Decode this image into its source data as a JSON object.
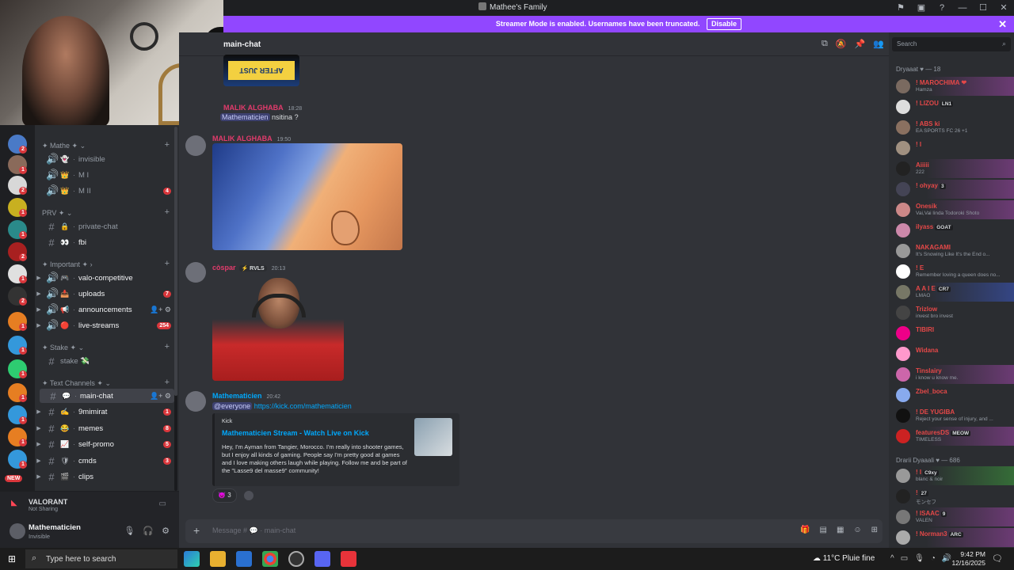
{
  "window": {
    "title": "Mathee's Family"
  },
  "banner": {
    "text": "Streamer Mode is enabled. Usernames have been truncated.",
    "disable_label": "Disable"
  },
  "server_badges": [
    "2",
    "1",
    "2",
    "1",
    "1",
    "2",
    "1",
    "2",
    "1",
    "1",
    "1",
    "1",
    "1",
    "1",
    "1",
    "1"
  ],
  "new_label": "NEW",
  "categories": {
    "mathe": "✦ Mathe ✦ ⌄",
    "prv": "PRV ✦ ⌄",
    "important": "✦ Important ✦ ›",
    "stake": "✦ Stake ✦ ⌄",
    "text_channels": "✦ Text Channels ✦ ⌄"
  },
  "channels": [
    {
      "name": "invisible",
      "emoji": "👻",
      "count": ""
    },
    {
      "name": "M I",
      "emoji": "👑",
      "count": ""
    },
    {
      "name": "M II",
      "emoji": "👑",
      "count": "4"
    },
    {
      "name": "private-chat",
      "emoji": "🔒",
      "count": ""
    },
    {
      "name": "fbi",
      "emoji": "👀",
      "count": ""
    },
    {
      "name": "valo-competitive",
      "emoji": "🎮",
      "count": ""
    },
    {
      "name": "uploads",
      "emoji": "📥",
      "count": "7"
    },
    {
      "name": "announcements",
      "emoji": "📢",
      "count": ""
    },
    {
      "name": "live-streams",
      "emoji": "🔴",
      "count": "254"
    },
    {
      "name": "stake 💸",
      "emoji": "",
      "count": ""
    },
    {
      "name": "main-chat",
      "emoji": "💬",
      "count": ""
    },
    {
      "name": "9mimirat",
      "emoji": "✍",
      "count": "1"
    },
    {
      "name": "memes",
      "emoji": "😂",
      "count": "8"
    },
    {
      "name": "self-promo",
      "emoji": "📈",
      "count": "5"
    },
    {
      "name": "cmds",
      "emoji": "🛡",
      "count": "3"
    },
    {
      "name": "clips",
      "emoji": "🎬",
      "count": ""
    }
  ],
  "voice": {
    "game": "VALORANT",
    "status": "Not Sharing"
  },
  "user": {
    "name": "Mathematicien",
    "status": "Invisible"
  },
  "chat": {
    "channel_name": "main-chat",
    "sticker_text": "AFTER JUST WEARING",
    "messages": [
      {
        "author": "MALIK ALGHABA",
        "time": "18:28",
        "mention": "Mathematicien",
        "text": "nsitina ?",
        "color": "#e23b6c"
      },
      {
        "author": "MALIK ALGHABA",
        "time": "19:50",
        "color": "#e23b6c"
      },
      {
        "author": "còspar",
        "tag": "⚡ RVLS",
        "time": "20:13",
        "color": "#e23b6c"
      },
      {
        "author": "Mathematicien",
        "time": "20:42",
        "mention": "@everyone",
        "link": "https://kick.com/mathematicien",
        "color": "#00a8fc"
      }
    ],
    "embed": {
      "provider": "Kick",
      "title": "Mathematicien Stream - Watch Live on Kick",
      "description": "Hey, I'm Ayman from Tangier, Morocco. I'm really into shooter games, but I enjoy all kinds of gaming. People say I'm pretty good at games and I love making others laugh while playing. Follow me and be part of the \"Lasse9 del masse9\" community!"
    },
    "reaction_count": "3",
    "composer_placeholder": "Message # 💬 · main-chat"
  },
  "members": {
    "search_placeholder": "Search",
    "group1": "Dryaaat ♥ — 18",
    "group2": "Drarii Dyaaali ♥ — 686",
    "list1": [
      {
        "name": "! MAROCHIMA ❤",
        "status": "Hamza",
        "tag": ""
      },
      {
        "name": "! LIZOU",
        "status": "",
        "tag": "LN1"
      },
      {
        "name": "! ABS ki",
        "status": "EA SPORTS FC 26 +1",
        "tag": ""
      },
      {
        "name": "! I",
        "status": "",
        "tag": ""
      },
      {
        "name": "Aiiiii",
        "status": "222",
        "tag": ""
      },
      {
        "name": "! ohyay",
        "status": "",
        "tag": "3"
      },
      {
        "name": "Onesik",
        "status": "Vai,Vai linda Todoroki Shoto",
        "tag": ""
      },
      {
        "name": "ilyass",
        "status": "",
        "tag": "GOAT"
      },
      {
        "name": "NAKAGAMI",
        "status": "It's Snowing Like It's the End o...",
        "tag": ""
      },
      {
        "name": "! E",
        "status": "Remember loving a queen does no...",
        "tag": ""
      },
      {
        "name": "A A I E",
        "status": "LMAO",
        "tag": "CR7"
      },
      {
        "name": "Trizlow",
        "status": "invest bro invest",
        "tag": ""
      },
      {
        "name": "TIBIRI",
        "status": "",
        "tag": ""
      },
      {
        "name": "Widana",
        "status": "",
        "tag": ""
      },
      {
        "name": "Tinslairy",
        "status": "i know u know me.",
        "tag": ""
      },
      {
        "name": "Zbel_boca",
        "status": "",
        "tag": ""
      },
      {
        "name": "! DE YUGIBA",
        "status": "Reject your sense of injury, and ...",
        "tag": ""
      },
      {
        "name": "featuresDS",
        "status": "TIMELESS",
        "tag": "MEOW"
      }
    ],
    "list2": [
      {
        "name": "! I",
        "status": "blanc & noir",
        "tag": "C9xy"
      },
      {
        "name": "!",
        "status": "モンセフ",
        "tag": "27"
      },
      {
        "name": "! ISAAC",
        "status": "VALEN",
        "tag": "9"
      },
      {
        "name": "! Norman3",
        "status": "",
        "tag": "ARC"
      }
    ]
  },
  "taskbar": {
    "search_placeholder": "Type here to search",
    "weather": "11°C  Pluie fine",
    "time": "9:42 PM",
    "date": "12/16/2025"
  }
}
